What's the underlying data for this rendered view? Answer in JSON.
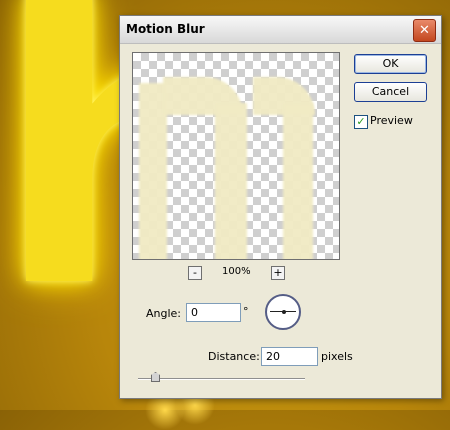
{
  "dialog": {
    "title": "Motion Blur",
    "close_icon": "close-icon",
    "buttons": {
      "ok": "OK",
      "cancel": "Cancel"
    },
    "preview": {
      "label": "Preview",
      "checked": true
    },
    "zoom": {
      "minus": "-",
      "plus": "+",
      "level": "100%"
    },
    "angle": {
      "label": "Angle:",
      "value": "0",
      "unit": "°"
    },
    "distance": {
      "label": "Distance:",
      "value": "20",
      "unit": "pixels",
      "slider_value": 20
    }
  },
  "colors": {
    "accent": "#1c3f94",
    "close_red": "#c3471f",
    "glow_yellow": "#f6dc1e"
  }
}
